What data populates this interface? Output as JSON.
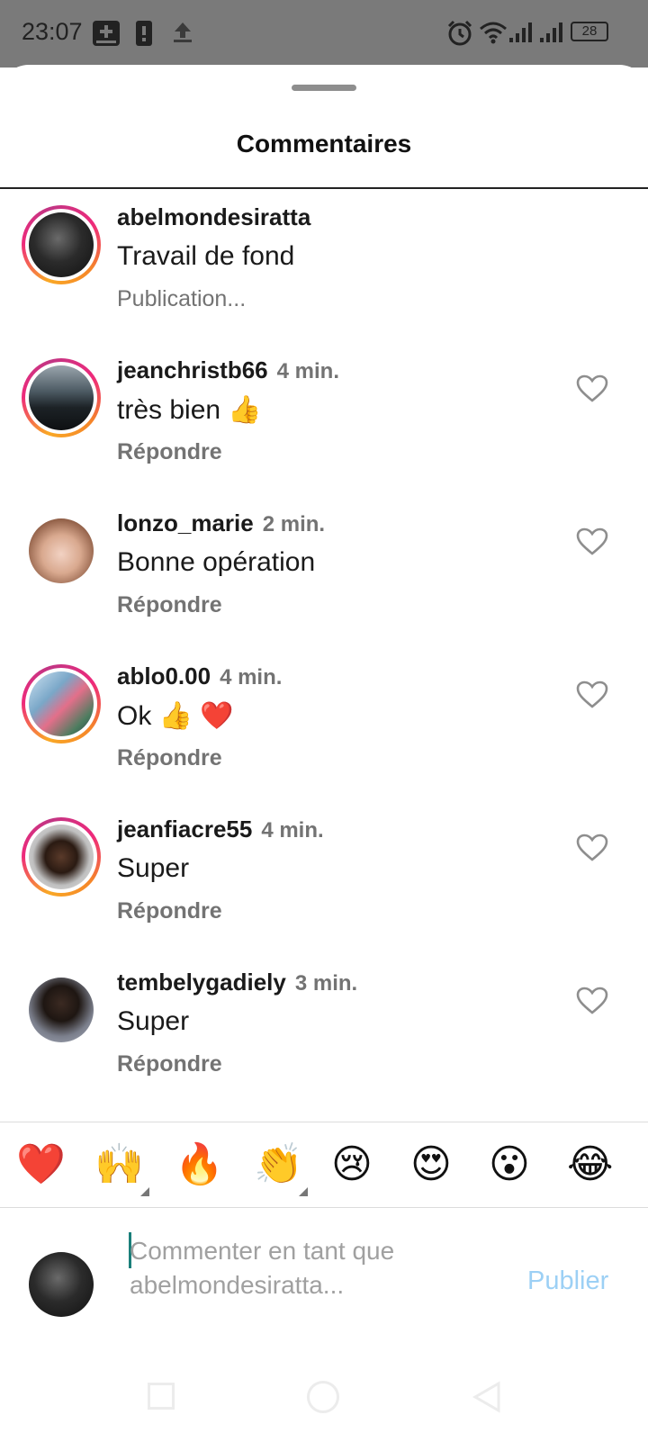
{
  "status_bar": {
    "time": "23:07",
    "battery": "28",
    "icons": [
      "add-box-icon",
      "phone-icon",
      "upload-icon",
      "alarm-icon",
      "wifi-icon",
      "signal-icon",
      "signal-icon",
      "battery-icon"
    ]
  },
  "sheet": {
    "title": "Commentaires"
  },
  "comments": [
    {
      "user": "abelmondesiratta",
      "time": "",
      "text": "Travail de fond",
      "action": "Publication...",
      "ring": true
    },
    {
      "user": "jeanchristb66",
      "time": "4 min.",
      "text": "très bien 👍",
      "action": "Répondre",
      "ring": true
    },
    {
      "user": "lonzo_marie",
      "time": "2 min.",
      "text": "Bonne opération",
      "action": "Répondre",
      "ring": false
    },
    {
      "user": "ablo0.00",
      "time": "4 min.",
      "text": "Ok 👍 ❤️",
      "action": "Répondre",
      "ring": true
    },
    {
      "user": "jeanfiacre55",
      "time": "4 min.",
      "text": "Super",
      "action": "Répondre",
      "ring": true
    },
    {
      "user": "tembelygadiely",
      "time": "3 min.",
      "text": "Super",
      "action": "Répondre",
      "ring": false
    }
  ],
  "reactions": [
    "❤️",
    "🙌",
    "🔥",
    "👏",
    "😢",
    "😍",
    "😮",
    "😂"
  ],
  "composer": {
    "placeholder": "Commenter en tant que abelmondesiratta...",
    "publish_label": "Publier"
  },
  "colors": {
    "accent_ring_start": "#f9a825",
    "accent_ring_end": "#c13584",
    "publish_disabled": "#9cd0f5"
  }
}
